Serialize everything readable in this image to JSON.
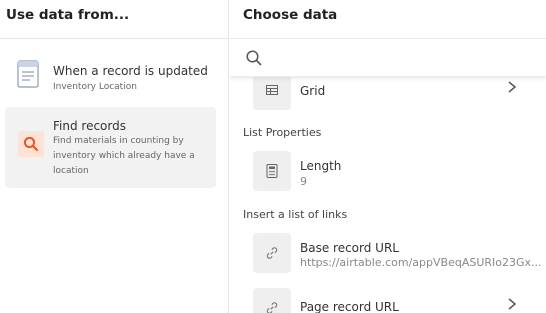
{
  "left_panel": {
    "title": "Use data from...",
    "sources": [
      {
        "title": "When a record is updated",
        "subtitle": "Inventory Location",
        "icon": "record-icon"
      },
      {
        "title": "Find records",
        "subtitle": "Find materials in counting by inventory which already have a location",
        "icon": "search-icon",
        "selected": true
      }
    ]
  },
  "right_panel": {
    "title": "Choose data",
    "search": {
      "value": "",
      "placeholder": ""
    },
    "rows": {
      "grid": {
        "label": "Grid",
        "icon": "grid-icon"
      },
      "length": {
        "label": "Length",
        "value": "9",
        "icon": "calculator-icon"
      },
      "base_url": {
        "label": "Base record URL",
        "value": "https://airtable.com/appVBeqASURIo23Gx...",
        "icon": "link-icon"
      },
      "page_url": {
        "label": "Page record URL",
        "icon": "link-icon"
      }
    },
    "sections": {
      "list_properties": "List Properties",
      "insert_links": "Insert a list of links"
    }
  },
  "colors": {
    "accent": "#e8572a",
    "accent_bg": "#fde3d6",
    "selected_bg": "#f2f2f2",
    "tile_bg": "#efefef"
  }
}
